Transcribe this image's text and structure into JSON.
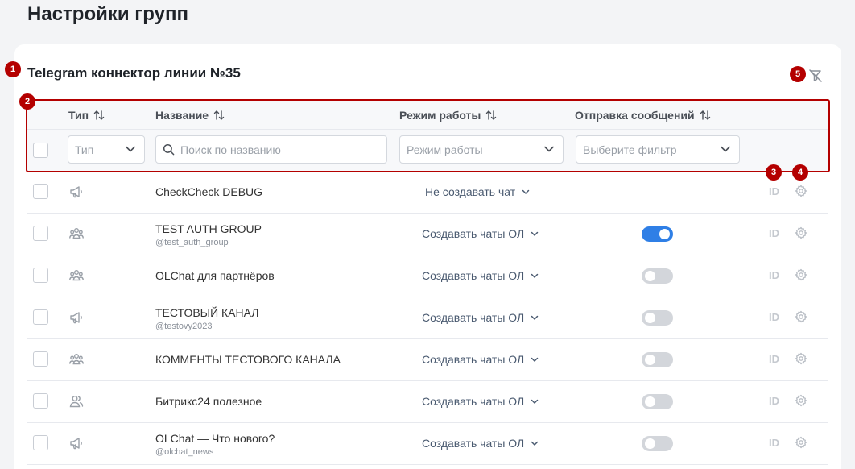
{
  "page_title": "Настройки групп",
  "connector_title": "Telegram коннектор линии №35",
  "markers": [
    "1",
    "2",
    "3",
    "4",
    "5"
  ],
  "columns": {
    "type": "Тип",
    "name": "Название",
    "mode": "Режим работы",
    "send": "Отправка сообщений"
  },
  "filters": {
    "type_value": "Тип",
    "search_placeholder": "Поиск по названию",
    "mode_placeholder": "Режим работы",
    "send_placeholder": "Выберите фильтр"
  },
  "id_label": "ID",
  "rows": [
    {
      "type_icon": "megaphone-icon",
      "name": "CheckCheck DEBUG",
      "handle": "",
      "mode": "Не создавать чат",
      "toggle": null
    },
    {
      "type_icon": "group-icon",
      "name": "TEST AUTH GROUP",
      "handle": "@test_auth_group",
      "mode": "Создавать чаты ОЛ",
      "toggle": true
    },
    {
      "type_icon": "group-icon",
      "name": "OLChat для партнёров",
      "handle": "",
      "mode": "Создавать чаты ОЛ",
      "toggle": false
    },
    {
      "type_icon": "megaphone-icon",
      "name": "ТЕСТОВЫЙ КАНАЛ",
      "handle": "@testovy2023",
      "mode": "Создавать чаты ОЛ",
      "toggle": false
    },
    {
      "type_icon": "group-icon",
      "name": "КОММЕНТЫ ТЕСТОВОГО КАНАЛА",
      "handle": "",
      "mode": "Создавать чаты ОЛ",
      "toggle": false
    },
    {
      "type_icon": "users-icon",
      "name": "Битрикс24 полезное",
      "handle": "",
      "mode": "Создавать чаты ОЛ",
      "toggle": false
    },
    {
      "type_icon": "megaphone-icon",
      "name": "OLChat — Что нового?",
      "handle": "@olchat_news",
      "mode": "Создавать чаты ОЛ",
      "toggle": false
    }
  ],
  "colors": {
    "marker": "#b40000",
    "toggle_on": "#2f7fe6",
    "toggle_off": "#d3d6db"
  }
}
